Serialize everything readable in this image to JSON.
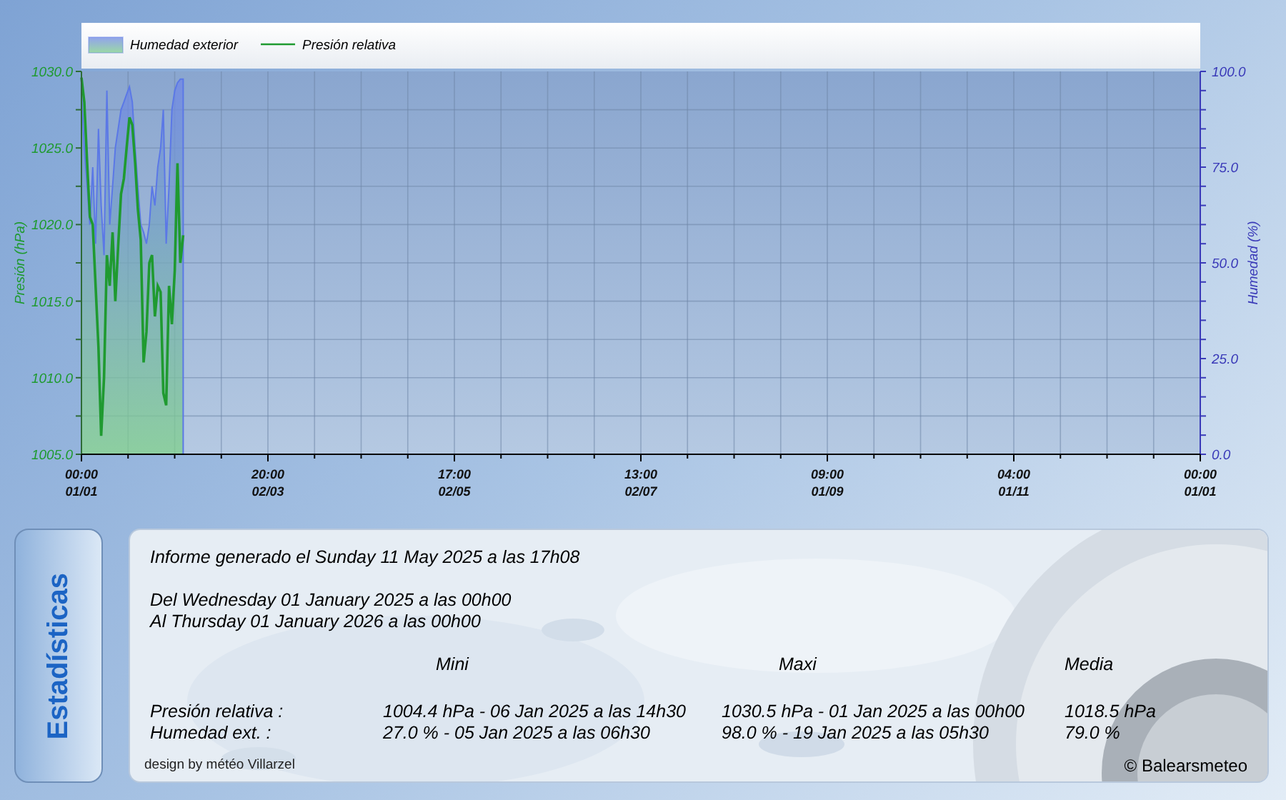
{
  "chart": {
    "chart_data": {
      "type": "line",
      "ylabel": "Presión (hPa)",
      "y2label": "Humedad (%)",
      "categories": [
        "00:00 01/01",
        null,
        null,
        null,
        null,
        null,
        null,
        null,
        null,
        null,
        null,
        null,
        null,
        null,
        null,
        null,
        null,
        null,
        null,
        null,
        null,
        null,
        null,
        null,
        null,
        null,
        null,
        null,
        null,
        null,
        null,
        null,
        null,
        null,
        null,
        null,
        null,
        null,
        null,
        null,
        null,
        null,
        null,
        null,
        null,
        null,
        null,
        null,
        null,
        null,
        null,
        null,
        null,
        null,
        null,
        null,
        null,
        null,
        null,
        null,
        null,
        null,
        null,
        null,
        null,
        null,
        "20:00 02/03",
        null,
        null,
        null,
        null,
        null,
        null,
        null,
        null,
        null,
        null,
        null,
        null,
        null,
        null,
        null,
        null,
        null,
        null,
        null,
        null,
        null,
        null,
        null,
        null,
        null,
        null,
        null,
        null,
        null,
        null,
        null,
        null,
        null,
        null,
        null,
        null,
        null,
        null,
        null,
        null,
        null,
        null,
        null,
        null,
        null,
        null,
        null,
        null,
        null,
        null,
        null,
        null,
        null,
        null,
        null,
        null,
        null,
        null,
        null,
        null,
        null,
        null,
        null,
        null,
        null,
        "17:00 02/05",
        null,
        null,
        null,
        null,
        null,
        null,
        null,
        null,
        null,
        null,
        null,
        null,
        null,
        null,
        null,
        null,
        null,
        null,
        null,
        null,
        null,
        null,
        null,
        null,
        null,
        null,
        null,
        null,
        null,
        null,
        null,
        null,
        null,
        null,
        null,
        null,
        null,
        null,
        null,
        null,
        null,
        null,
        null,
        null,
        null,
        null,
        null,
        null,
        null,
        null,
        null,
        null,
        null,
        null,
        null,
        null,
        null,
        null,
        null,
        null,
        null,
        null,
        null,
        null,
        null,
        "13:00 02/07",
        null,
        null,
        null,
        null,
        null,
        null,
        null,
        null,
        null,
        null,
        null,
        null,
        null,
        null,
        null,
        null,
        null,
        null,
        null,
        null,
        null,
        null,
        null,
        null,
        null,
        null,
        null,
        null,
        null,
        null,
        null,
        null,
        null,
        null,
        null,
        null,
        null,
        null,
        null,
        null,
        null,
        null,
        null,
        null,
        null,
        null,
        null,
        null,
        null,
        null,
        null,
        null,
        null,
        null,
        null,
        null,
        null,
        null,
        null,
        null,
        null,
        null,
        null,
        null,
        null,
        "09:00 01/09",
        null,
        null,
        null,
        null,
        null,
        null,
        null,
        null,
        null,
        null,
        null,
        null,
        null,
        null,
        null,
        null,
        null,
        null,
        null,
        null,
        null,
        null,
        null,
        null,
        null,
        null,
        null,
        null,
        null,
        null,
        null,
        null,
        null,
        null,
        null,
        null,
        null,
        null,
        null,
        null,
        null,
        null,
        null,
        null,
        null,
        null,
        null,
        null,
        null,
        null,
        null,
        null,
        null,
        null,
        null,
        null,
        null,
        null,
        null,
        null,
        null,
        null,
        null,
        null,
        null,
        "04:00 01/11",
        null,
        null,
        null,
        null,
        null,
        null,
        null,
        null,
        null,
        null,
        null,
        null,
        null,
        null,
        null,
        null,
        null,
        null,
        null,
        null,
        null,
        null,
        null,
        null,
        null,
        null,
        null,
        null,
        null,
        null,
        null,
        null,
        null,
        null,
        null,
        null,
        null,
        null,
        null,
        null,
        null,
        null,
        null,
        null,
        null,
        null,
        null,
        null,
        null,
        null,
        null,
        null,
        null,
        null,
        null,
        null,
        null,
        null,
        null,
        null,
        null,
        null,
        null,
        null,
        null,
        "00:00 01/01"
      ],
      "series": [
        {
          "name": "Humedad exterior",
          "color": "#5b78e6",
          "type": "area",
          "axis": "y2",
          "values": [
            95,
            80,
            70,
            60,
            75,
            55,
            85,
            65,
            52,
            95,
            60,
            70,
            80,
            85,
            90,
            92,
            94,
            96,
            92,
            80,
            70,
            60,
            58,
            55,
            60,
            70,
            65,
            75,
            80,
            90,
            55,
            70,
            90,
            95,
            97,
            98,
            98,
            null,
            null,
            null,
            null,
            null,
            null,
            null,
            null,
            null,
            null,
            null,
            null,
            null,
            null,
            null,
            null,
            null,
            null,
            null,
            null,
            null,
            null,
            null,
            null,
            null,
            null,
            null,
            null,
            null,
            null,
            null,
            null,
            null,
            null,
            null,
            null,
            null,
            null,
            null,
            null,
            null,
            null,
            null,
            null,
            null,
            null,
            null,
            null,
            null,
            null,
            null,
            null,
            null,
            null,
            null,
            null,
            null,
            null,
            null,
            null,
            null,
            null,
            null,
            null,
            null,
            null,
            null,
            null,
            null,
            null,
            null,
            null,
            null,
            null,
            null,
            null,
            null,
            null,
            null,
            null,
            null,
            null,
            null,
            null,
            null,
            null,
            null,
            null,
            null,
            null,
            null,
            null,
            null,
            null,
            null,
            null,
            null,
            null,
            null,
            null,
            null,
            null,
            null,
            null,
            null,
            null,
            null,
            null,
            null,
            null,
            null,
            null,
            null,
            null,
            null,
            null,
            null,
            null,
            null,
            null,
            null,
            null,
            null,
            null,
            null,
            null,
            null,
            null,
            null,
            null,
            null,
            null,
            null,
            null,
            null,
            null,
            null,
            null,
            null,
            null,
            null,
            null,
            null,
            null,
            null,
            null,
            null,
            null,
            null,
            null,
            null,
            null,
            null,
            null,
            null,
            null,
            null,
            null,
            null,
            null,
            null,
            null,
            null,
            null,
            null,
            null,
            null,
            null,
            null,
            null,
            null,
            null,
            null,
            null,
            null,
            null,
            null,
            null,
            null,
            null,
            null,
            null,
            null,
            null,
            null,
            null,
            null,
            null,
            null,
            null,
            null,
            null,
            null,
            null,
            null,
            null,
            null,
            null,
            null,
            null,
            null,
            null,
            null,
            null,
            null,
            null,
            null,
            null,
            null,
            null,
            null,
            null,
            null,
            null,
            null,
            null,
            null,
            null,
            null,
            null,
            null,
            null,
            null,
            null,
            null,
            null,
            null,
            null,
            null,
            null,
            null,
            null,
            null,
            null,
            null,
            null,
            null,
            null,
            null,
            null,
            null,
            null,
            null,
            null,
            null,
            null,
            null,
            null,
            null,
            null,
            null,
            null,
            null,
            null,
            null,
            null,
            null,
            null,
            null,
            null,
            null,
            null,
            null,
            null,
            null,
            null,
            null,
            null,
            null,
            null,
            null,
            null,
            null,
            null,
            null,
            null,
            null,
            null,
            null,
            null,
            null,
            null,
            null,
            null,
            null,
            null,
            null,
            null,
            null,
            null,
            null,
            null,
            null,
            null,
            null,
            null,
            null,
            null,
            null,
            null,
            null,
            null,
            null,
            null,
            null,
            null,
            null,
            null,
            null,
            null,
            null,
            null,
            null,
            null,
            null,
            null,
            null,
            null,
            null,
            null,
            null,
            null,
            null,
            null,
            null,
            null,
            null,
            null,
            null,
            null,
            null,
            null,
            null,
            null,
            null,
            null,
            null,
            null,
            null,
            null,
            null,
            null,
            null,
            null,
            null,
            null,
            null,
            null,
            null,
            null,
            null,
            null,
            null,
            null,
            null,
            null,
            null,
            null,
            null,
            null
          ]
        },
        {
          "name": "Presión relativa",
          "color": "#1f9a30",
          "values": [
            1029.6,
            1028,
            1024,
            1020.5,
            1020,
            1016,
            1012,
            1006.2,
            1010,
            1018,
            1016,
            1019.5,
            1015,
            1018.6,
            1022,
            1023,
            1025,
            1027,
            1026.5,
            1024,
            1021,
            1019,
            1011,
            1013,
            1017.5,
            1018,
            1014,
            1016,
            1015.6,
            1009,
            1008.2,
            1016,
            1013.5,
            1017,
            1024,
            1017.5,
            1019.3,
            null,
            null,
            null,
            null,
            null,
            null,
            null,
            null,
            null,
            null,
            null,
            null,
            null,
            null,
            null,
            null,
            null,
            null,
            null,
            null,
            null,
            null,
            null,
            null,
            null,
            null,
            null,
            null,
            null,
            null,
            null,
            null,
            null,
            null,
            null,
            null,
            null,
            null,
            null,
            null,
            null,
            null,
            null,
            null,
            null,
            null,
            null,
            null,
            null,
            null,
            null,
            null,
            null,
            null,
            null,
            null,
            null,
            null,
            null,
            null,
            null,
            null,
            null,
            null,
            null,
            null,
            null,
            null,
            null,
            null,
            null,
            null,
            null,
            null,
            null,
            null,
            null,
            null,
            null,
            null,
            null,
            null,
            null,
            null,
            null,
            null,
            null,
            null,
            null,
            null,
            null,
            null,
            null,
            null,
            null,
            null,
            null,
            null,
            null,
            null,
            null,
            null,
            null,
            null,
            null,
            null,
            null,
            null,
            null,
            null,
            null,
            null,
            null,
            null,
            null,
            null,
            null,
            null,
            null,
            null,
            null,
            null,
            null,
            null,
            null,
            null,
            null,
            null,
            null,
            null,
            null,
            null,
            null,
            null,
            null,
            null,
            null,
            null,
            null,
            null,
            null,
            null,
            null,
            null,
            null,
            null,
            null,
            null,
            null,
            null,
            null,
            null,
            null,
            null,
            null,
            null,
            null,
            null,
            null,
            null,
            null,
            null,
            null,
            null,
            null,
            null,
            null,
            null,
            null,
            null,
            null,
            null,
            null,
            null,
            null,
            null,
            null,
            null,
            null,
            null,
            null,
            null,
            null,
            null,
            null,
            null,
            null,
            null,
            null,
            null,
            null,
            null,
            null,
            null,
            null,
            null,
            null,
            null,
            null,
            null,
            null,
            null,
            null,
            null,
            null,
            null,
            null,
            null,
            null,
            null,
            null,
            null,
            null,
            null,
            null,
            null,
            null,
            null,
            null,
            null,
            null,
            null,
            null,
            null,
            null,
            null,
            null,
            null,
            null,
            null,
            null,
            null,
            null,
            null,
            null,
            null,
            null,
            null,
            null,
            null,
            null,
            null,
            null,
            null,
            null,
            null,
            null,
            null,
            null,
            null,
            null,
            null,
            null,
            null,
            null,
            null,
            null,
            null,
            null,
            null,
            null,
            null,
            null,
            null,
            null,
            null,
            null,
            null,
            null,
            null,
            null,
            null,
            null,
            null,
            null,
            null,
            null,
            null,
            null,
            null,
            null,
            null,
            null,
            null,
            null,
            null,
            null,
            null,
            null,
            null,
            null,
            null,
            null,
            null,
            null,
            null,
            null,
            null,
            null,
            null,
            null,
            null,
            null,
            null,
            null,
            null,
            null,
            null,
            null,
            null,
            null,
            null,
            null,
            null,
            null,
            null,
            null,
            null,
            null,
            null,
            null,
            null,
            null,
            null,
            null,
            null,
            null,
            null,
            null,
            null,
            null,
            null,
            null,
            null,
            null,
            null,
            null,
            null,
            null,
            null,
            null,
            null,
            null,
            null,
            null,
            null,
            null,
            null,
            null,
            null,
            null,
            null,
            null,
            null,
            null,
            null,
            null,
            null,
            null,
            null
          ]
        }
      ],
      "grid": true,
      "legend": "top",
      "ylim": [
        1005,
        1030
      ],
      "y2lim": [
        0,
        100
      ],
      "yticks": [
        {
          "value": 1005,
          "label": "1005.0"
        },
        {
          "value": 1010,
          "label": "1010.0"
        },
        {
          "value": 1015,
          "label": "1015.0"
        },
        {
          "value": 1020,
          "label": "1020.0"
        },
        {
          "value": 1025,
          "label": "1025.0"
        },
        {
          "value": 1030,
          "label": "1030.0"
        }
      ],
      "y2ticks": [
        {
          "value": 0,
          "label": "0.0"
        },
        {
          "value": 25,
          "label": "25.0"
        },
        {
          "value": 50,
          "label": "50.0"
        },
        {
          "value": 75,
          "label": "75.0"
        },
        {
          "value": 100,
          "label": "100.0"
        }
      ]
    }
  },
  "side_tab": {
    "label": "Estadísticas"
  },
  "stats": {
    "generated": "Informe generado el Sunday 11 May 2025 a las 17h08",
    "from": "Del Wednesday 01 January 2025 a las 00h00",
    "to": "Al Thursday 01 January 2026 a las 00h00",
    "columns": [
      "Mini",
      "Maxi",
      "Media"
    ],
    "rows": [
      {
        "label": "Presión relativa :",
        "cells": [
          "1004.4 hPa - 06 Jan 2025 a las 14h30",
          "1030.5 hPa - 01 Jan 2025 a las 00h00",
          "1018.5 hPa"
        ]
      },
      {
        "label": "Humedad ext. :",
        "cells": [
          "27.0 % - 05 Jan 2025 a las 06h30",
          "98.0 % - 19 Jan 2025 a las 05h30",
          "79.0 %"
        ]
      }
    ]
  },
  "footer": {
    "credit": "design by météo Villarzel",
    "copyright": "© Balearsmeteo"
  }
}
